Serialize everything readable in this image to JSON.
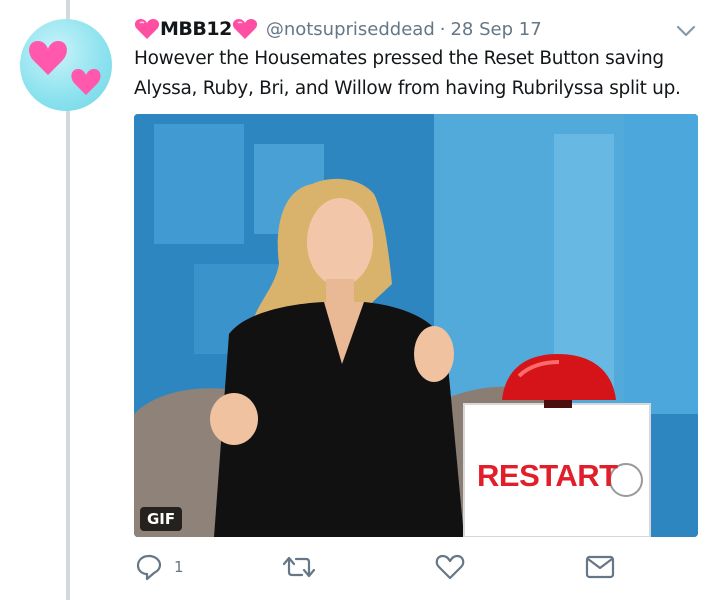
{
  "tweet": {
    "display_name": "MBB12",
    "handle": "@notsupriseddead",
    "separator": "·",
    "date": "28 Sep 17",
    "text": "However the Housemates pressed the Reset Button saving Alyssa, Ruby, Bri, and Willow from having Rubrilyssa split up."
  },
  "media": {
    "badge": "GIF",
    "button_label": "RESTART"
  },
  "actions": {
    "reply_count": "1"
  },
  "icons": {
    "avatar": "hearts-avatar",
    "name_prefix": "heart-emoji",
    "name_suffix": "heart-emoji",
    "menu": "chevron-down-icon",
    "reply": "reply-icon",
    "retweet": "retweet-icon",
    "like": "heart-icon",
    "message": "envelope-icon"
  },
  "colors": {
    "text": "#14171a",
    "secondary": "#657786",
    "thread_line": "#cfd9de",
    "heart": "#ff4fa3",
    "restart_red": "#e01f2b"
  }
}
